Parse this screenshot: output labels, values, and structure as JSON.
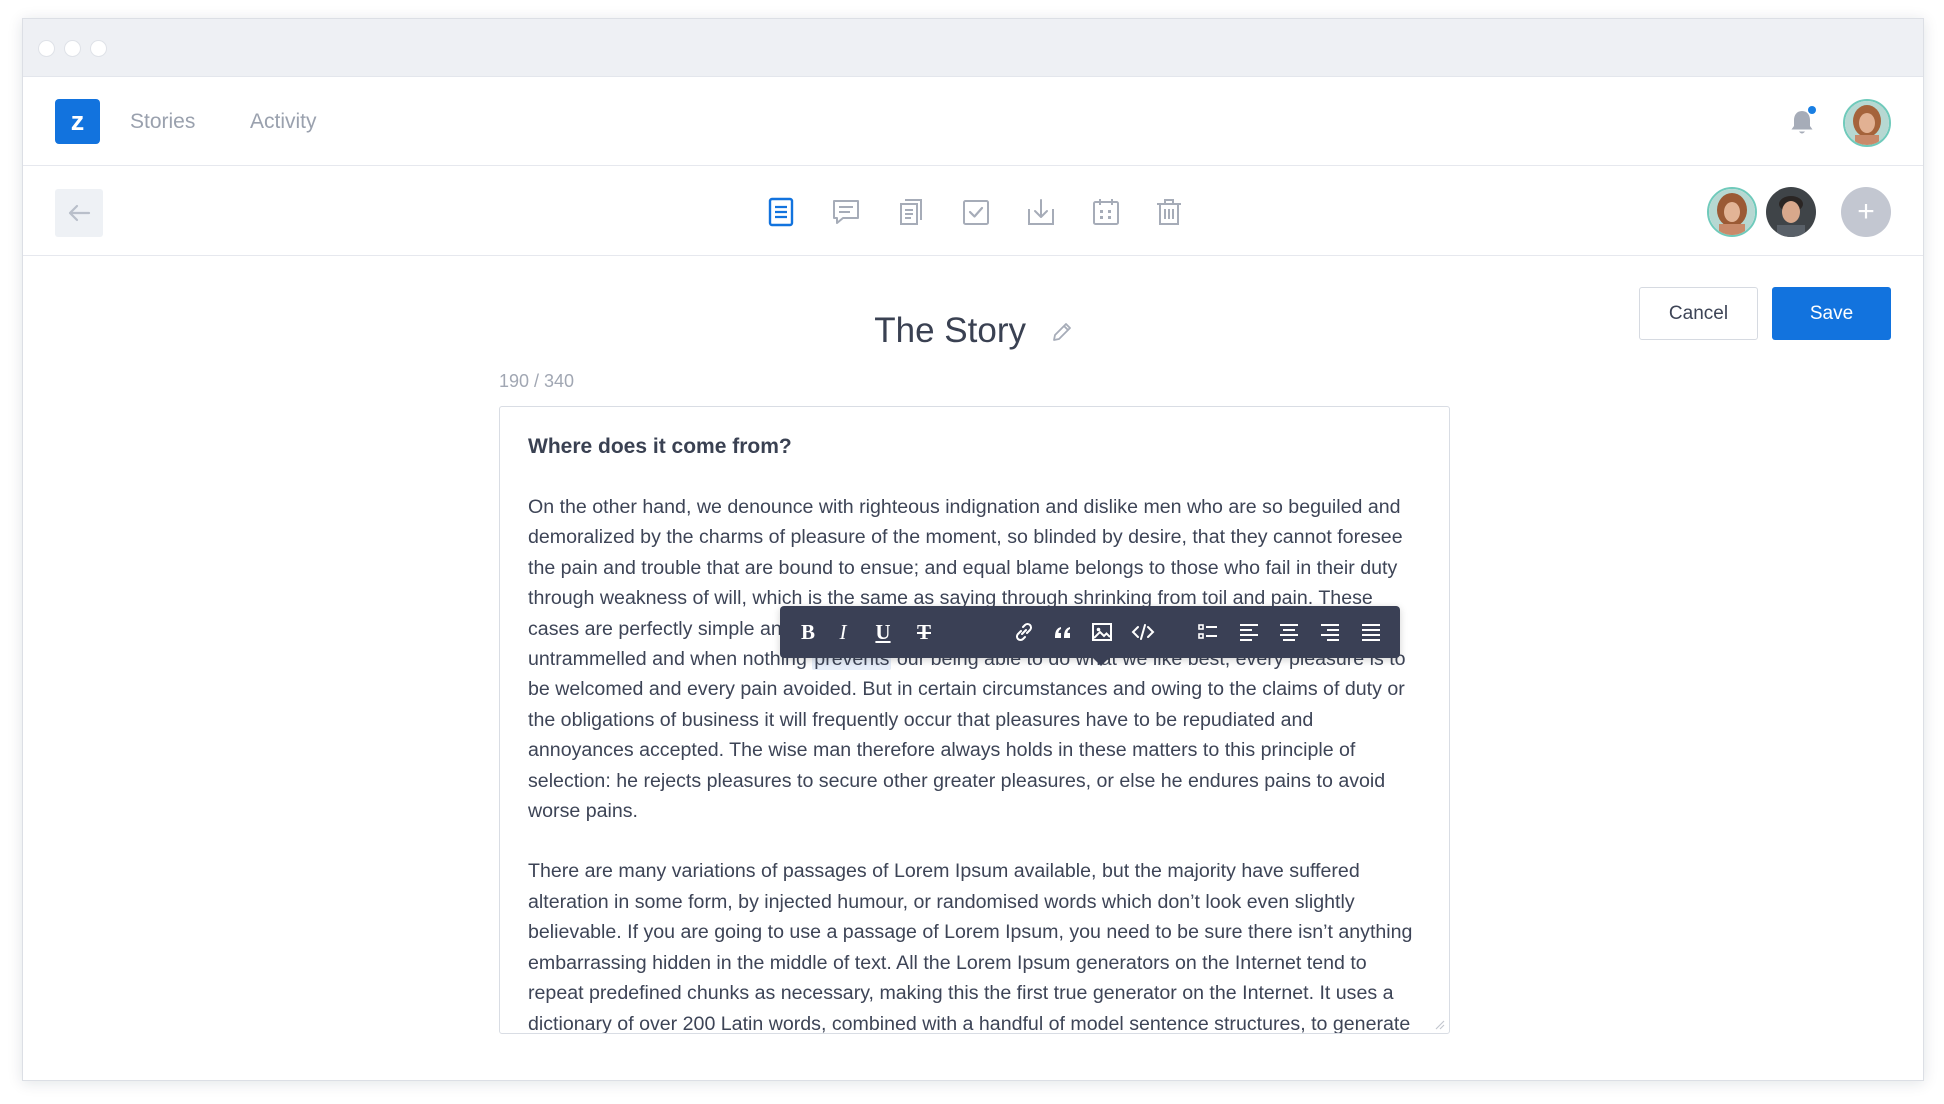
{
  "nav": {
    "logo": "z",
    "links": [
      "Stories",
      "Activity"
    ]
  },
  "editor_toolbar": {
    "tools": [
      "document-icon",
      "comment-icon",
      "copy-icon",
      "checkbox-icon",
      "download-icon",
      "calendar-icon",
      "trash-icon"
    ],
    "active_tool": "document-icon",
    "add_member_label": "+"
  },
  "actions": {
    "cancel": "Cancel",
    "save": "Save"
  },
  "document": {
    "title": "The Story",
    "counter": "190 / 340",
    "heading": "Where does it come from?",
    "para1_before": "On the other hand, we denounce with righteous indignation and dislike men who are so beguiled and demoralized by the charms of pleasure of the moment, so blinded by desire, that they cannot foresee the pain and trouble that are bound to ensue; and equal blame belongs to those who fail in their duty through weakness of will, which is the same as saying through shrinking from toil and pain. These cases are perfectly simple and easy to distinguish. In a free hour, when our power of choice is untrammelled and when nothing ",
    "para1_highlight": "prevents",
    "para1_after": " our being able to do what we like best, every pleasure is to be welcomed and every pain avoided. But in certain circumstances and owing to the claims of duty or the obligations of business it will frequently occur that pleasures have to be repudiated and annoyances accepted. The wise man therefore always holds in these matters to this principle of selection: he rejects pleasures to secure other greater pleasures, or else he endures pains to avoid worse pains.",
    "para2": "There are many variations of passages of Lorem Ipsum available, but the majority have suffered alteration in some form, by injected humour, or randomised words which don’t look even slightly believable. If you are going to use a passage of Lorem Ipsum, you need to be sure there isn’t anything embarrassing hidden in the middle of text. All the Lorem Ipsum generators on the Internet tend to repeat predefined chunks as necessary, making this the first true generator on the Internet. It uses a dictionary of over 200 Latin words, combined with a handful of model sentence structures, to generate Lorem Ipsum which looks reasonable."
  },
  "format_bar": {
    "bold": "B",
    "italic": "I",
    "underline": "U",
    "strike": "T",
    "tools": [
      "link-icon",
      "quote-icon",
      "image-icon",
      "code-icon",
      "list-icon",
      "align-left-icon",
      "align-center-icon",
      "align-right-icon",
      "justify-icon"
    ]
  },
  "colors": {
    "accent": "#1273de",
    "format_bar_bg": "#3a4055",
    "highlight": "#e6eef9",
    "notification_dot": "#1a7fe3"
  }
}
